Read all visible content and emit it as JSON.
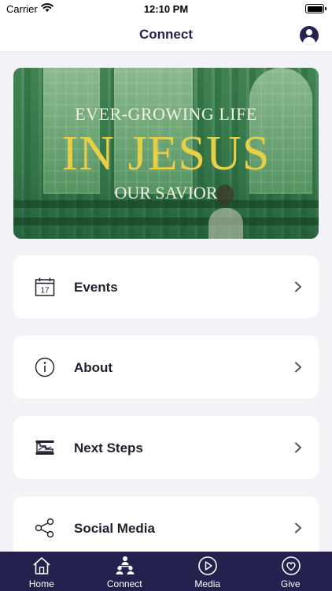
{
  "status_bar": {
    "carrier": "Carrier",
    "time": "12:10 PM"
  },
  "header": {
    "title": "Connect",
    "profile_icon": "user-circle-icon"
  },
  "banner": {
    "line1": "EVER-GROWING LIFE",
    "line2": "IN JESUS",
    "line3": "OUR SAVIOR"
  },
  "menu": {
    "items": [
      {
        "label": "Events",
        "icon": "calendar-icon",
        "calendar_day": "17"
      },
      {
        "label": "About",
        "icon": "info-icon"
      },
      {
        "label": "Next Steps",
        "icon": "steps-icon"
      },
      {
        "label": "Social Media",
        "icon": "share-icon"
      }
    ]
  },
  "tab_bar": {
    "selected": "Connect",
    "tabs": [
      {
        "label": "Home",
        "icon": "home-icon"
      },
      {
        "label": "Connect",
        "icon": "group-icon"
      },
      {
        "label": "Media",
        "icon": "play-icon"
      },
      {
        "label": "Give",
        "icon": "heart-icon"
      }
    ]
  },
  "colors": {
    "primary": "#23214d",
    "background": "#f3f3f7",
    "banner_gold": "#e9cf47"
  }
}
